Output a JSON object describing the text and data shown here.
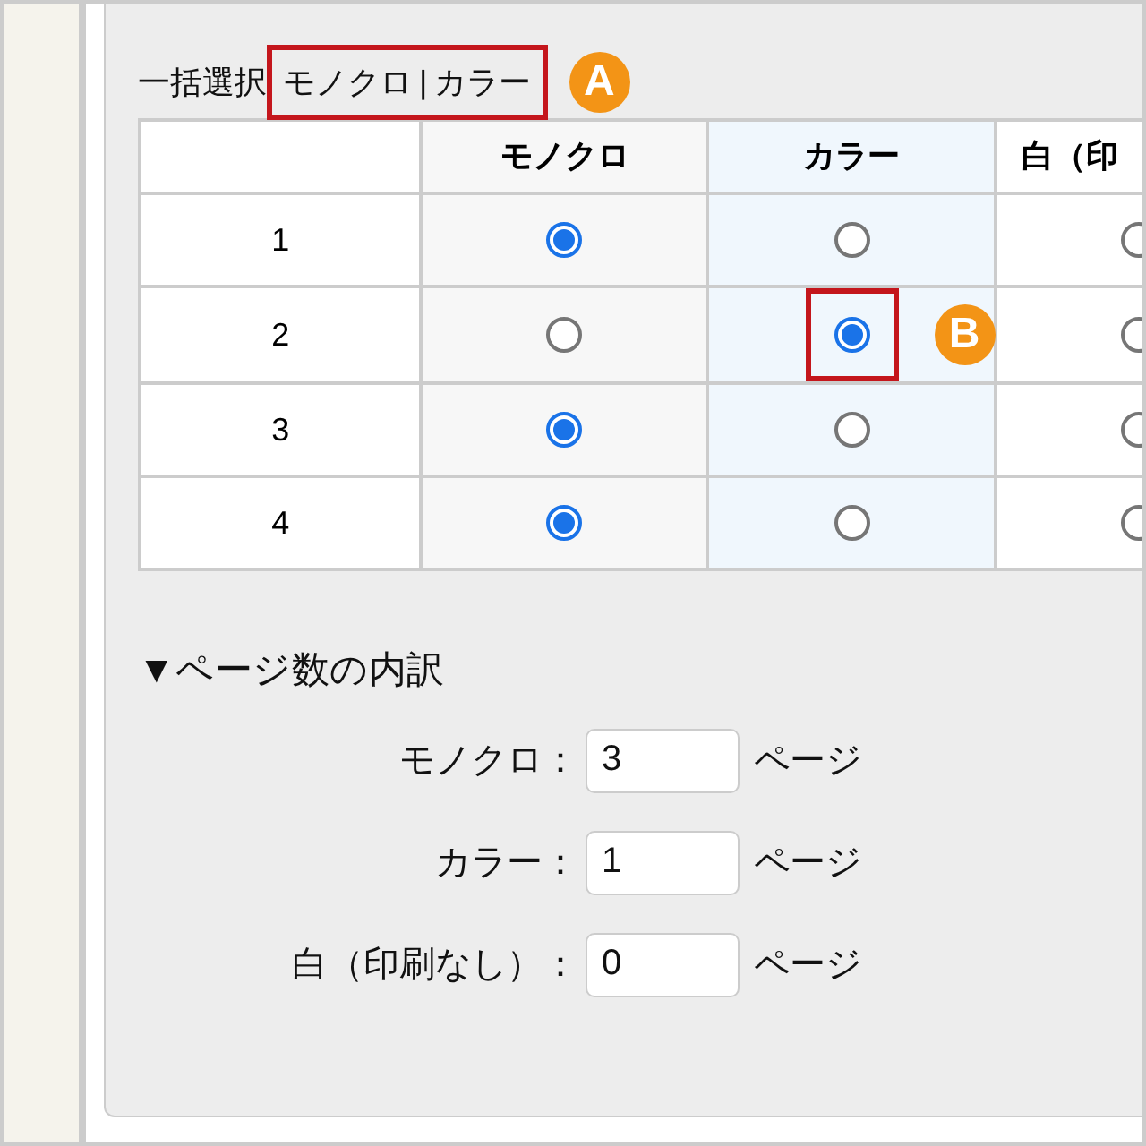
{
  "bulk_select": {
    "label": "一括選択",
    "links": [
      {
        "label": "モノクロ"
      },
      {
        "label": "カラー"
      }
    ],
    "separator": "|",
    "callout": "A"
  },
  "table": {
    "columns": [
      "モノクロ",
      "カラー",
      "白（印"
    ],
    "rows": [
      {
        "label": "1",
        "options": [
          {
            "selected": true
          },
          {
            "selected": false
          },
          {
            "selected": false
          }
        ]
      },
      {
        "label": "2",
        "options": [
          {
            "selected": false
          },
          {
            "selected": true,
            "callout": "B"
          },
          {
            "selected": false
          }
        ]
      },
      {
        "label": "3",
        "options": [
          {
            "selected": true
          },
          {
            "selected": false
          },
          {
            "selected": false
          }
        ]
      },
      {
        "label": "4",
        "options": [
          {
            "selected": true
          },
          {
            "selected": false
          },
          {
            "selected": false
          }
        ]
      }
    ]
  },
  "breakdown": {
    "title": "▼ページ数の内訳",
    "rows": [
      {
        "label": "モノクロ：",
        "value": "3",
        "unit": "ページ"
      },
      {
        "label": "カラー：",
        "value": "1",
        "unit": "ページ"
      },
      {
        "label": "白（印刷なし）：",
        "value": "0",
        "unit": "ページ"
      }
    ]
  }
}
